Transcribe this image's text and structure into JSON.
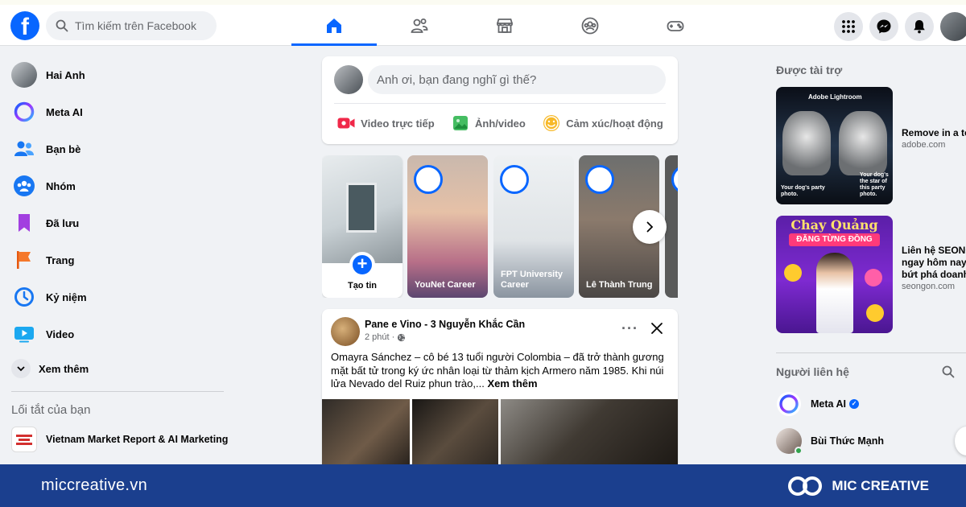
{
  "colors": {
    "fb_blue": "#0866ff",
    "footer_bg": "#1b3f8e",
    "page_bg": "#f0f2f5",
    "online": "#31a24c"
  },
  "header": {
    "logo_letter": "f",
    "search_placeholder": "Tìm kiếm trên Facebook",
    "nav_tabs": [
      {
        "icon": "home-icon",
        "active": true
      },
      {
        "icon": "friends-icon",
        "active": false
      },
      {
        "icon": "marketplace-icon",
        "active": false
      },
      {
        "icon": "groups-icon",
        "active": false
      },
      {
        "icon": "gaming-icon",
        "active": false
      }
    ],
    "actions": [
      "menu-grid-icon",
      "messenger-icon",
      "notifications-icon",
      "profile-avatar"
    ]
  },
  "sidebar": {
    "items": [
      {
        "label": "Hai Anh",
        "icon": "profile-avatar"
      },
      {
        "label": "Meta AI",
        "icon": "meta-ai-icon"
      },
      {
        "label": "Bạn bè",
        "icon": "friends-icon"
      },
      {
        "label": "Nhóm",
        "icon": "groups-icon"
      },
      {
        "label": "Đã lưu",
        "icon": "bookmark-icon"
      },
      {
        "label": "Trang",
        "icon": "flag-icon"
      },
      {
        "label": "Kỷ niệm",
        "icon": "memories-clock-icon"
      },
      {
        "label": "Video",
        "icon": "video-icon"
      }
    ],
    "see_more": "Xem thêm",
    "shortcuts_title": "Lối tắt của bạn",
    "shortcuts": [
      {
        "label": "Vietnam Market Report & AI Marketing"
      }
    ]
  },
  "composer": {
    "placeholder": "Anh ơi, bạn đang nghĩ gì thế?",
    "actions": [
      {
        "label": "Video trực tiếp",
        "icon": "live-video-icon",
        "color": "#f02849"
      },
      {
        "label": "Ảnh/video",
        "icon": "photo-icon",
        "color": "#45bd62"
      },
      {
        "label": "Cảm xúc/hoạt động",
        "icon": "feeling-icon",
        "color": "#f7b928"
      }
    ]
  },
  "stories": {
    "create_label": "Tạo tin",
    "items": [
      {
        "name": "YouNet Career"
      },
      {
        "name": "FPT University Career"
      },
      {
        "name": "Lê Thành Trung"
      }
    ]
  },
  "post": {
    "author": "Pane e Vino - 3 Nguyễn Khắc Cần",
    "time": "2 phút",
    "text": "Omayra Sánchez – cô bé 13 tuổi người Colombia – đã trở thành gương mặt bất tử trong ký ức nhân loại từ thảm kịch Armero năm 1985. Khi núi lửa Nevado del Ruiz phun trào,...",
    "see_more": "Xem thêm"
  },
  "right": {
    "sponsored_title": "Được tài trợ",
    "ads": [
      {
        "title": "Remove in a to",
        "domain": "adobe.com",
        "brand": "Adobe Lightroom",
        "caption_left": "Your dog's party photo.",
        "caption_right": "Your dog's the star of this party photo."
      },
      {
        "title_line1": "Liên hệ SEONG",
        "title_line2": "ngay hôm nay",
        "title_line3": "bứt phá doanh",
        "domain": "seongon.com",
        "headline": "Chạy Quảng Cáo",
        "subheadline": "ĐĂNG TỪNG ĐỒNG"
      }
    ],
    "contacts_title": "Người liên hệ",
    "contacts": [
      {
        "name": "Meta AI",
        "verified": true,
        "online": false
      },
      {
        "name": "Bùi Thức Mạnh",
        "verified": false,
        "online": true
      }
    ]
  },
  "footer": {
    "url": "miccreative.vn",
    "brand": "MIC CREATIVE"
  }
}
